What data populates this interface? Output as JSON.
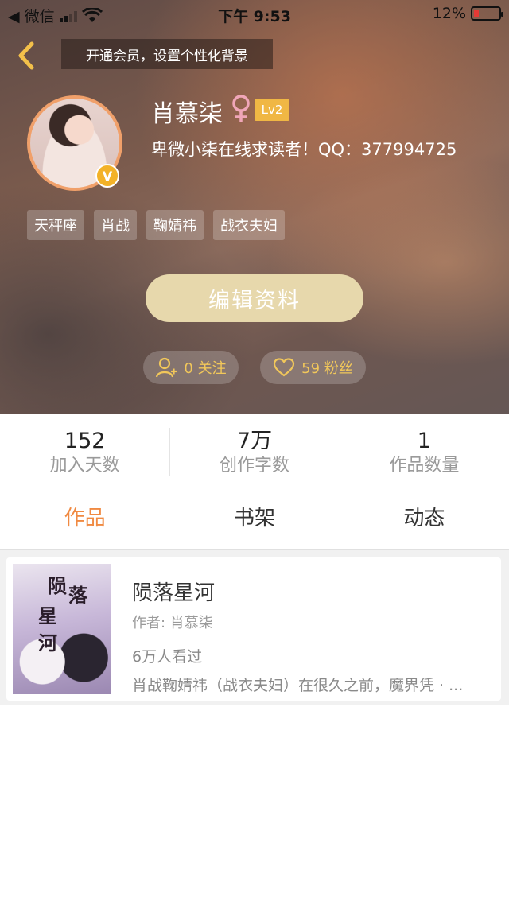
{
  "status_bar": {
    "carrier": "◀ 微信",
    "time": "下午 9:53",
    "battery": "12%",
    "battery_color": "#e53935"
  },
  "header": {
    "back_icon": "chevron-left-icon",
    "vip_banner": "开通会员，设置个性化背景",
    "username": "肖慕柒",
    "gender_icon": "female-icon",
    "level": "Lv2",
    "bio": "卑微小柒在线求读者！QQ：377994725",
    "verified_badge": "V",
    "tags": [
      "天秤座",
      "肖战",
      "鞠婧祎",
      "战衣夫妇"
    ],
    "edit_button": "编辑资料",
    "following": "0 关注",
    "fans": "59 粉丝"
  },
  "stats": [
    {
      "value": "152",
      "label": "加入天数"
    },
    {
      "value": "7万",
      "label": "创作字数"
    },
    {
      "value": "1",
      "label": "作品数量"
    }
  ],
  "tabs": [
    {
      "label": "作品",
      "active": true
    },
    {
      "label": "书架",
      "active": false
    },
    {
      "label": "动态",
      "active": false
    }
  ],
  "works": [
    {
      "title": "陨落星河",
      "author": "作者: 肖慕柒",
      "views": "6万人看过",
      "description": "肖战鞠婧祎（战衣夫妇）在很久之前，魔界凭 · ...",
      "cover_text": "陨落星河"
    }
  ],
  "colors": {
    "accent": "#f08a42",
    "gold": "#f1c75a",
    "edit_button_bg": "#e7d8ac"
  }
}
